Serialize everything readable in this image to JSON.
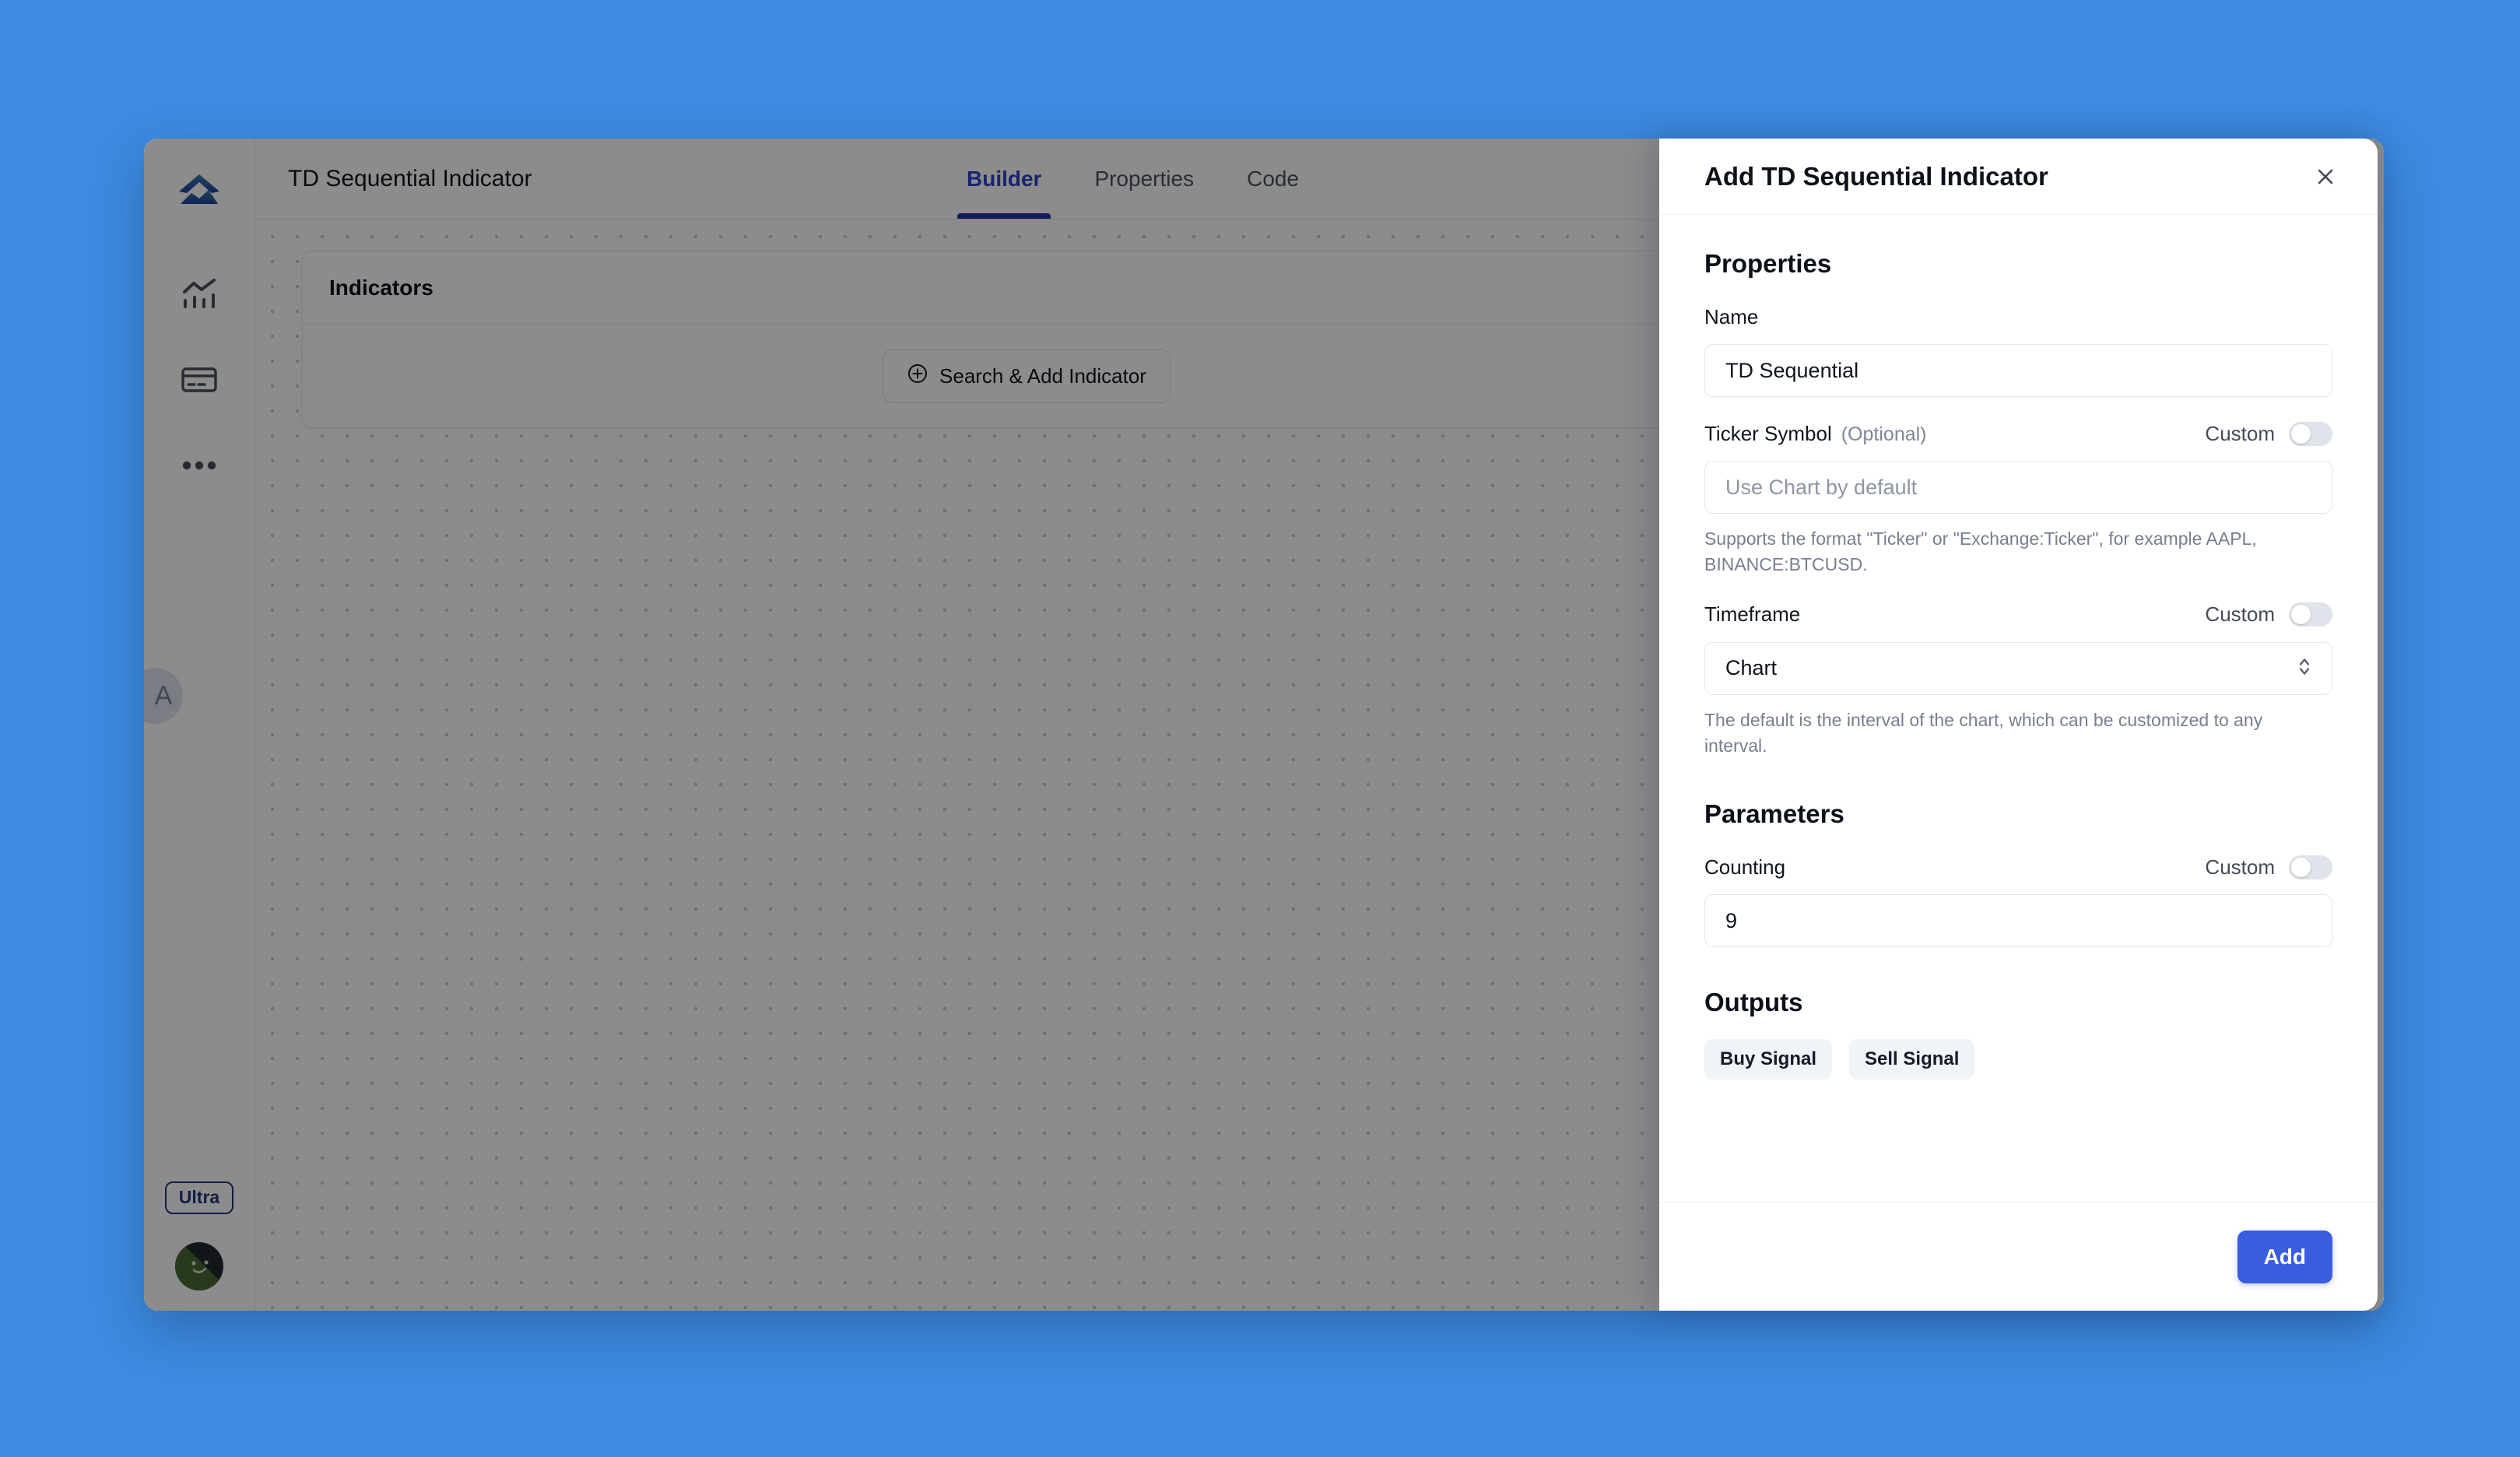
{
  "app": {
    "document_title": "TD Sequential Indicator",
    "tabs": [
      {
        "label": "Builder",
        "active": true
      },
      {
        "label": "Properties",
        "active": false
      },
      {
        "label": "Code",
        "active": false
      }
    ],
    "sidebar": {
      "logo_name": "mountain-logo",
      "items": [
        {
          "name": "chart-icon"
        },
        {
          "name": "card-icon"
        },
        {
          "name": "more-icon"
        }
      ],
      "workspace_initial": "A",
      "plan_badge": "Ultra"
    },
    "canvas": {
      "indicators_card": {
        "title": "Indicators",
        "add_symbol": "+",
        "search_button": "Search & Add Indicator"
      }
    }
  },
  "drawer": {
    "title": "Add TD Sequential Indicator",
    "close_label": "×",
    "properties": {
      "heading": "Properties",
      "name": {
        "label": "Name",
        "value": "TD Sequential"
      },
      "ticker": {
        "label": "Ticker Symbol",
        "optional": "(Optional)",
        "custom_label": "Custom",
        "custom_on": false,
        "placeholder": "Use Chart by default",
        "value": "",
        "helper": "Supports the format \"Ticker\" or \"Exchange:Ticker\", for example AAPL, BINANCE:BTCUSD."
      },
      "timeframe": {
        "label": "Timeframe",
        "custom_label": "Custom",
        "custom_on": false,
        "value": "Chart",
        "helper": "The default is the interval of the chart, which can be customized to any interval."
      }
    },
    "parameters": {
      "heading": "Parameters",
      "counting": {
        "label": "Counting",
        "custom_label": "Custom",
        "custom_on": false,
        "value": "9"
      }
    },
    "outputs": {
      "heading": "Outputs",
      "chips": [
        "Buy Signal",
        "Sell Signal"
      ]
    },
    "footer": {
      "add_label": "Add"
    }
  },
  "colors": {
    "background": "#3d8ae0",
    "accent_blue": "#3a5ce0",
    "tab_active": "#2c43c9",
    "chip_bg": "#f0f3f8",
    "badge_outline": "#23357a"
  }
}
